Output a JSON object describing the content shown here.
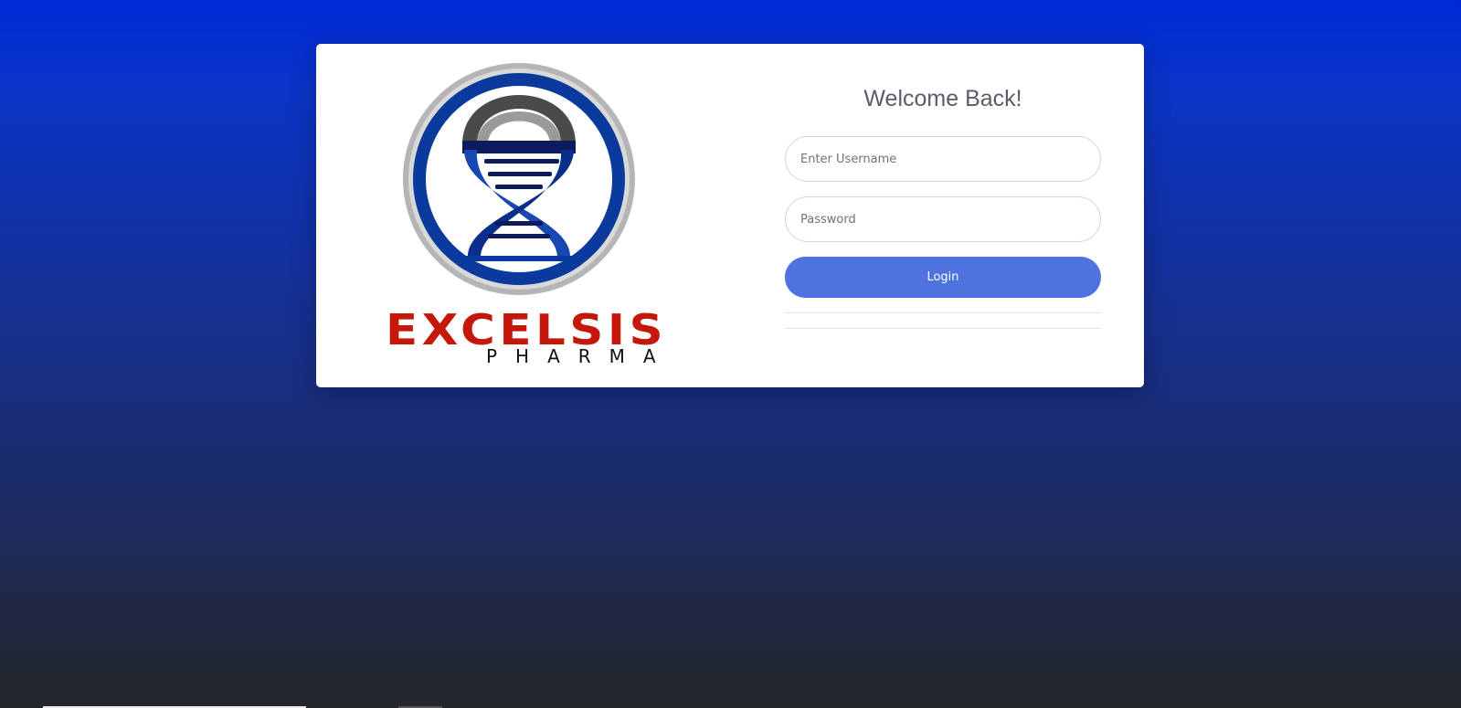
{
  "brand": {
    "name": "EXCELSIS",
    "tagline": "PHARMA",
    "logo_icon": "dna-helix-icon",
    "colors": {
      "red": "#c3180b",
      "blue": "#0a3a9c",
      "navy": "#0d1a5e",
      "silver": "#b8b8b8"
    }
  },
  "login": {
    "title": "Welcome Back!",
    "username_placeholder": "Enter Username",
    "password_placeholder": "Password",
    "login_label": "Login",
    "accent": "#4e73df"
  }
}
